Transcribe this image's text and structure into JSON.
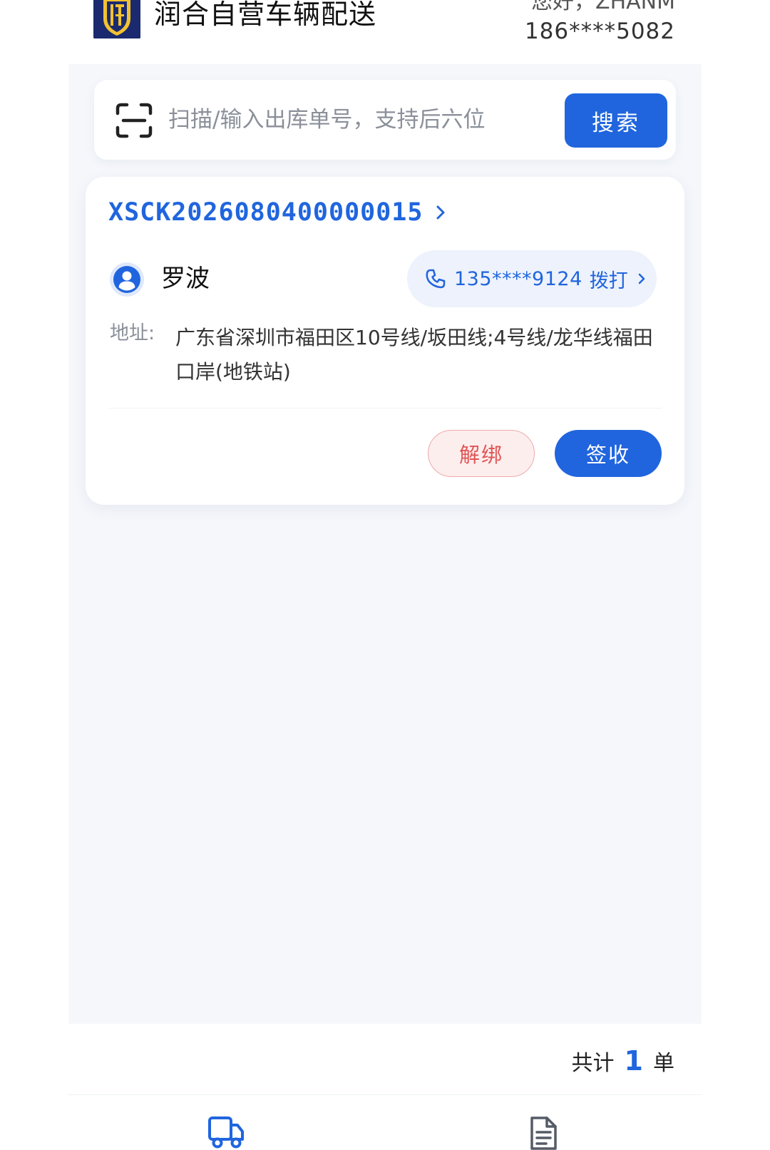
{
  "header": {
    "app_title": "润合自营车辆配送",
    "greeting": "您好，ZHANM",
    "user_phone": "186****5082"
  },
  "search": {
    "placeholder": "扫描/输入出库单号，支持后六位",
    "button_label": "搜索"
  },
  "orders": [
    {
      "order_number": "XSCK2026080400000015",
      "customer_name": "罗波",
      "phone": "135****9124",
      "call_label": "拨打",
      "address_label": "地址:",
      "address": "广东省深圳市福田区10号线/坂田线;4号线/龙华线福田口岸(地铁站)",
      "unbind_label": "解绑",
      "sign_label": "签收"
    }
  ],
  "summary": {
    "prefix": "共计",
    "count": "1",
    "suffix": "单"
  },
  "bottom_nav": {
    "items": [
      {
        "icon": "truck-icon",
        "active": true
      },
      {
        "icon": "document-icon",
        "active": false
      }
    ]
  },
  "colors": {
    "primary": "#2065de",
    "danger": "#e25555",
    "background": "#f5f7fb"
  }
}
